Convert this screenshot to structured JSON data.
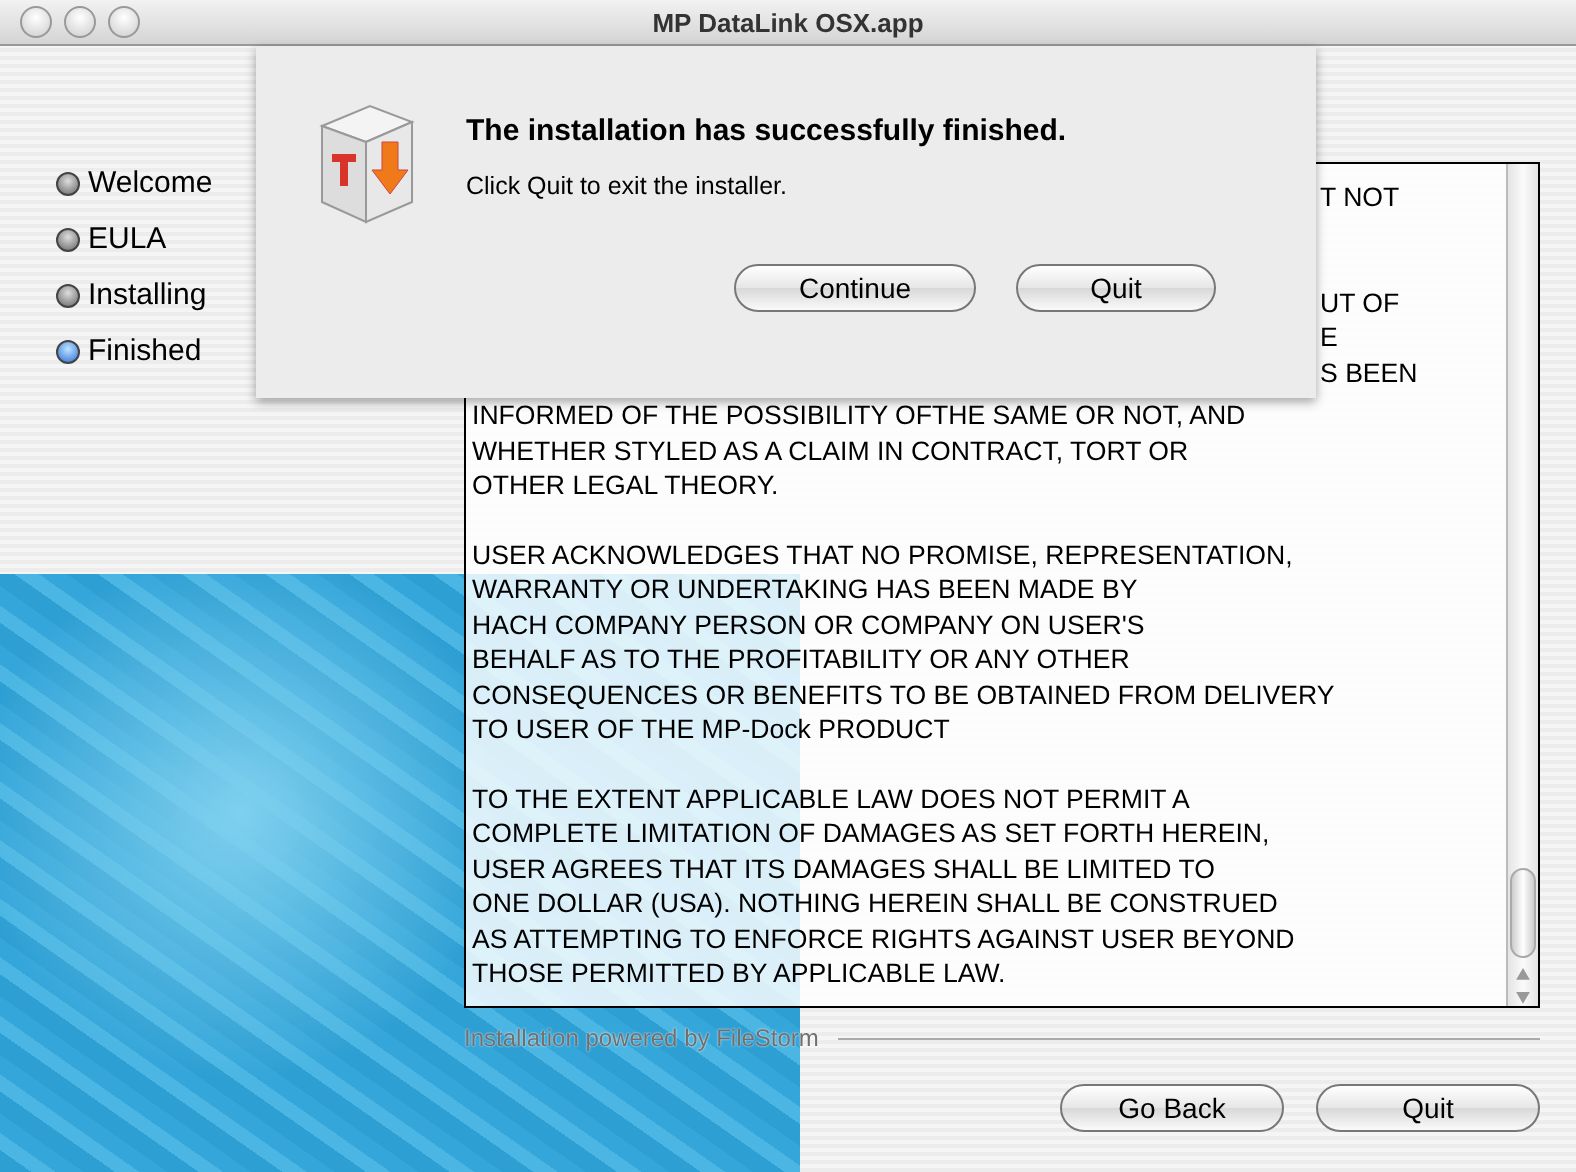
{
  "window": {
    "title": "MP DataLink OSX.app"
  },
  "steps": [
    {
      "label": "Welcome",
      "selected": false
    },
    {
      "label": "EULA",
      "selected": false
    },
    {
      "label": "Installing",
      "selected": false
    },
    {
      "label": "Finished",
      "selected": true
    }
  ],
  "covered_line_ends": [
    "T NOT",
    "UT OF",
    "E",
    "S BEEN"
  ],
  "license": [
    [
      "INFORMED OF THE POSSIBILITY OFTHE SAME OR NOT, AND",
      "WHETHER STYLED AS A CLAIM IN CONTRACT, TORT OR",
      "OTHER LEGAL THEORY."
    ],
    [
      "USER ACKNOWLEDGES THAT NO PROMISE, REPRESENTATION,",
      "WARRANTY OR UNDERTAKING HAS BEEN MADE BY",
      "HACH COMPANY PERSON OR COMPANY ON USER'S",
      "BEHALF AS TO THE PROFITABILITY OR ANY OTHER",
      "CONSEQUENCES OR BENEFITS TO BE OBTAINED FROM DELIVERY",
      "TO USER OF THE MP-Dock PRODUCT"
    ],
    [
      "TO THE EXTENT APPLICABLE LAW DOES NOT PERMIT A",
      "COMPLETE LIMITATION OF DAMAGES AS SET FORTH HEREIN,",
      "USER AGREES THAT ITS DAMAGES SHALL BE LIMITED TO",
      "ONE DOLLAR (USA).  NOTHING HEREIN SHALL BE CONSTRUED",
      "AS ATTEMPTING TO ENFORCE RIGHTS AGAINST USER BEYOND",
      "THOSE PERMITTED BY APPLICABLE LAW."
    ]
  ],
  "footer": "Installation powered by FileStorm",
  "buttons": [
    "Go Back",
    "Quit"
  ],
  "sheet": {
    "title": "The installation has successfully finished.",
    "message": "Click Quit to exit the installer.",
    "buttons": [
      "Continue",
      "Quit"
    ]
  }
}
